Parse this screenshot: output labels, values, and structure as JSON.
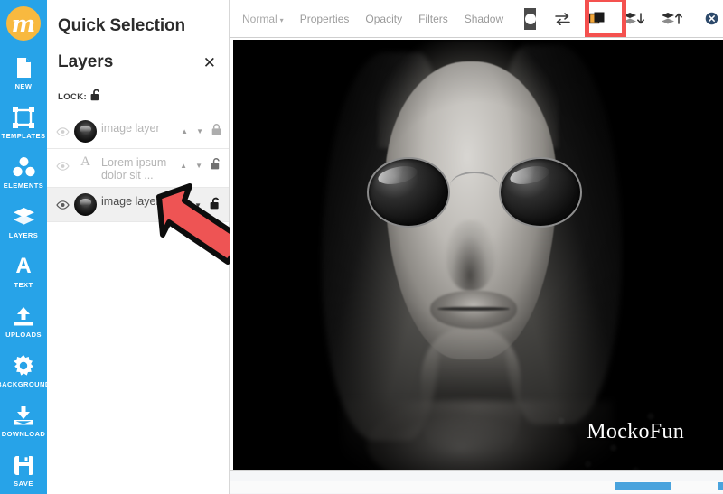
{
  "app": {
    "brand_mark": "m",
    "brand_color": "#f8b93f",
    "rail_color": "#27a3e8",
    "accent_red": "#f4514f",
    "scrollbar_blue": "#4aa3dd"
  },
  "rail": {
    "items": [
      {
        "label": "NEW",
        "icon": "page-icon"
      },
      {
        "label": "TEMPLATES",
        "icon": "frame-icon"
      },
      {
        "label": "ELEMENTS",
        "icon": "shapes-icon"
      },
      {
        "label": "LAYERS",
        "icon": "layers-icon"
      },
      {
        "label": "TEXT",
        "icon": "letter-a-icon"
      },
      {
        "label": "UPLOADS",
        "icon": "upload-icon"
      },
      {
        "label": "BACKGROUND",
        "icon": "gear-icon"
      },
      {
        "label": "DOWNLOAD",
        "icon": "download-icon"
      },
      {
        "label": "SAVE",
        "icon": "floppy-disk-icon"
      }
    ]
  },
  "panel": {
    "quick_selection_title": "Quick Selection",
    "layers_title": "Layers",
    "close_label": "✕",
    "lock_label": "LOCK:",
    "lock_state": "unlocked",
    "move_up_label": "▲",
    "move_down_label": "▼",
    "layers": [
      {
        "name": "image layer",
        "type": "image",
        "visible": true,
        "locked": true,
        "selected": false,
        "thumbnail": "portrait-thumbnail"
      },
      {
        "name": "Lorem ipsum dolor sit ...",
        "type": "text",
        "visible": true,
        "locked": false,
        "selected": false,
        "thumbnail": "letter-a-icon"
      },
      {
        "name": "image layer",
        "type": "image",
        "visible": true,
        "locked": false,
        "selected": true,
        "thumbnail": "portrait-thumbnail"
      }
    ]
  },
  "toolbar": {
    "blend_mode": "Normal",
    "blend_caret": "▾",
    "properties_label": "Properties",
    "opacity_label": "Opacity",
    "filters_label": "Filters",
    "shadow_label": "Shadow",
    "mask_swatch_icon": "mask-circle-icon",
    "flip_icon": "flip-horizontal-icon",
    "duplicate_icon": "duplicate-layer-icon",
    "send_backward_icon": "layers-down-icon",
    "bring_forward_icon": "layers-up-icon",
    "delete_icon": "delete-circle-icon",
    "highlighted_button": "duplicate-layer-icon"
  },
  "canvas": {
    "watermark": "MockoFun",
    "background_color": "#000000",
    "content_description": "black-and-white portrait of a woman wearing round sunglasses"
  },
  "scrollbar": {
    "orientation": "horizontal",
    "thumb_color": "#4aa3dd"
  },
  "annotation": {
    "arrow_color": "#f4514f",
    "points_to": "image layer (selected)"
  }
}
